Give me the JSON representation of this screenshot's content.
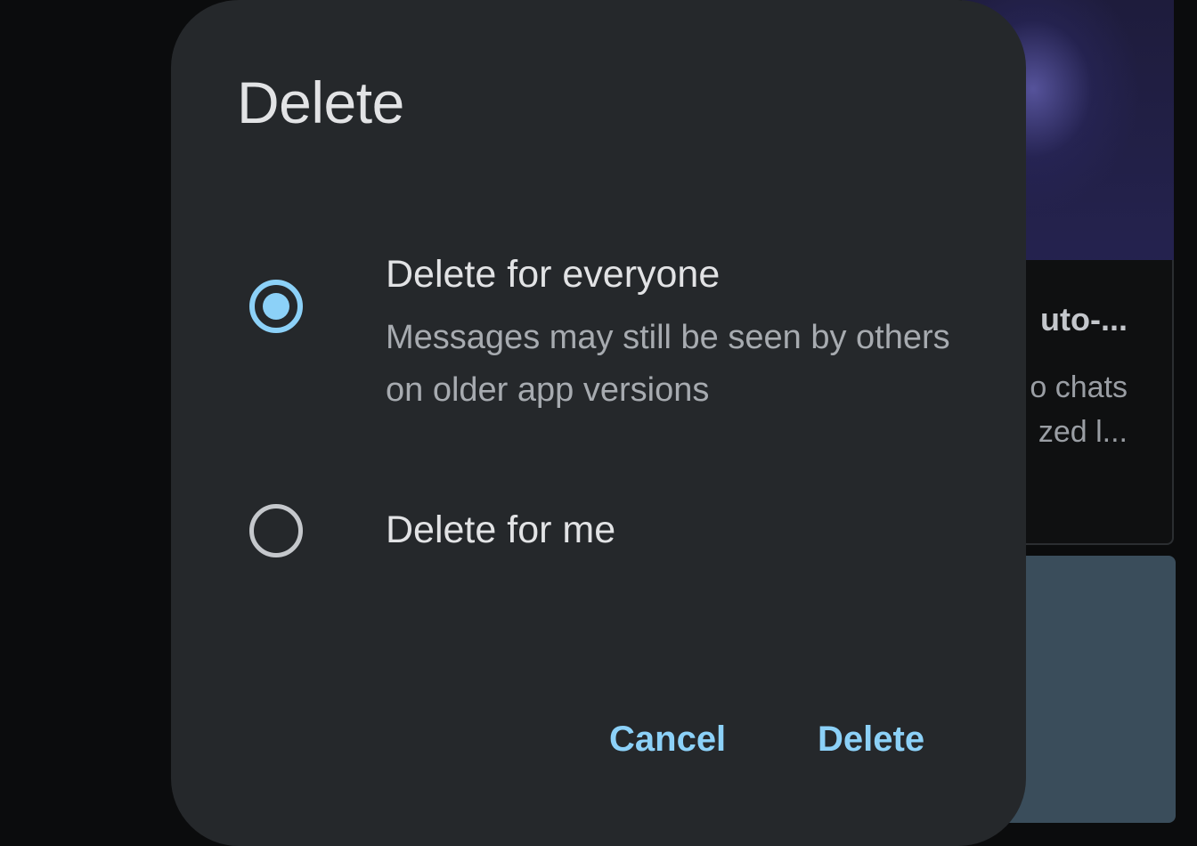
{
  "background": {
    "card_title": "uto-...",
    "card_line_1": "o chats",
    "card_line_2": "zed l..."
  },
  "dialog": {
    "title": "Delete",
    "options": [
      {
        "label": "Delete for everyone",
        "description": "Messages may still be seen by others on older app versions",
        "selected": true
      },
      {
        "label": "Delete for me",
        "selected": false
      }
    ],
    "cancel_label": "Cancel",
    "confirm_label": "Delete"
  },
  "colors": {
    "accent": "#8cd1f8",
    "dialog_bg": "#25282b",
    "page_bg": "#0b0c0d"
  }
}
